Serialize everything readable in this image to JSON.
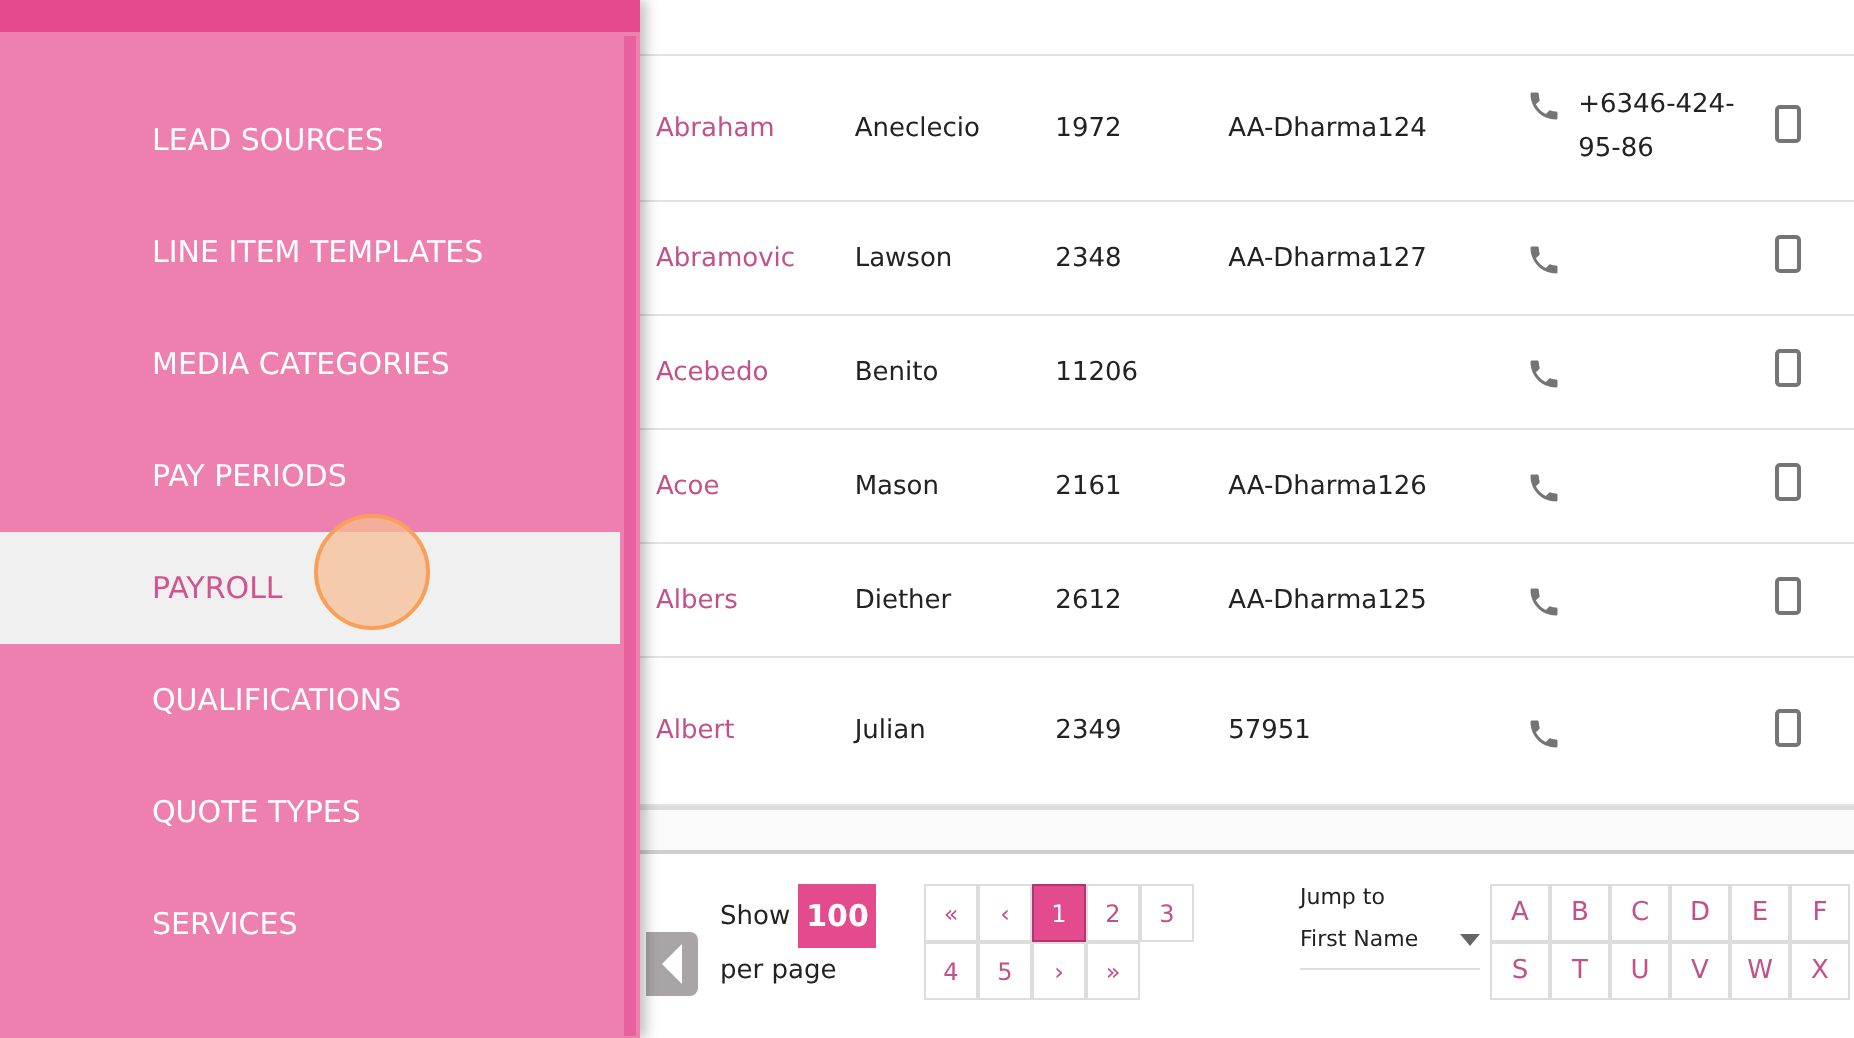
{
  "sidebar": {
    "items": [
      {
        "label": "LEAD SOURCES",
        "selected": false
      },
      {
        "label": "LINE ITEM TEMPLATES",
        "selected": false
      },
      {
        "label": "MEDIA CATEGORIES",
        "selected": false
      },
      {
        "label": "PAY PERIODS",
        "selected": false
      },
      {
        "label": "PAYROLL",
        "selected": true
      },
      {
        "label": "QUALIFICATIONS",
        "selected": false
      },
      {
        "label": "QUOTE TYPES",
        "selected": false
      },
      {
        "label": "SERVICES",
        "selected": false
      }
    ]
  },
  "table": {
    "rows": [
      {
        "last_name": "Abraham",
        "first_name": "Aneclecio",
        "number": "1972",
        "code": "AA-Dharma124",
        "phone": "+6346-424-95-86"
      },
      {
        "last_name": "Abramovic",
        "first_name": "Lawson",
        "number": "2348",
        "code": "AA-Dharma127"
      },
      {
        "last_name": "Acebedo",
        "first_name": "Benito",
        "number": "11206"
      },
      {
        "last_name": "Acoe",
        "first_name": "Mason",
        "number": "2161",
        "code": "AA-Dharma126"
      },
      {
        "last_name": "Albers",
        "first_name": "Diether",
        "number": "2612",
        "code": "AA-Dharma125"
      },
      {
        "last_name": "Albert",
        "first_name": "Julian",
        "number": "2349",
        "code": "57951"
      }
    ]
  },
  "footer": {
    "show_label": "Show",
    "page_size": "100",
    "per_page_label": "per page",
    "pages": [
      [
        {
          "label": "«",
          "selected": false
        },
        {
          "label": "‹",
          "selected": false
        },
        {
          "label": "1",
          "selected": true
        },
        {
          "label": "2",
          "selected": false
        },
        {
          "label": "3",
          "selected": false
        }
      ],
      [
        {
          "label": "4",
          "selected": false
        },
        {
          "label": "5",
          "selected": false
        },
        {
          "label": "›",
          "selected": false
        },
        {
          "label": "»",
          "selected": false
        }
      ]
    ],
    "jump_label": "Jump to",
    "jump_value": "First Name",
    "letters": [
      [
        "A",
        "B",
        "C",
        "D",
        "E",
        "F"
      ],
      [
        "S",
        "T",
        "U",
        "V",
        "W",
        "X"
      ]
    ]
  }
}
